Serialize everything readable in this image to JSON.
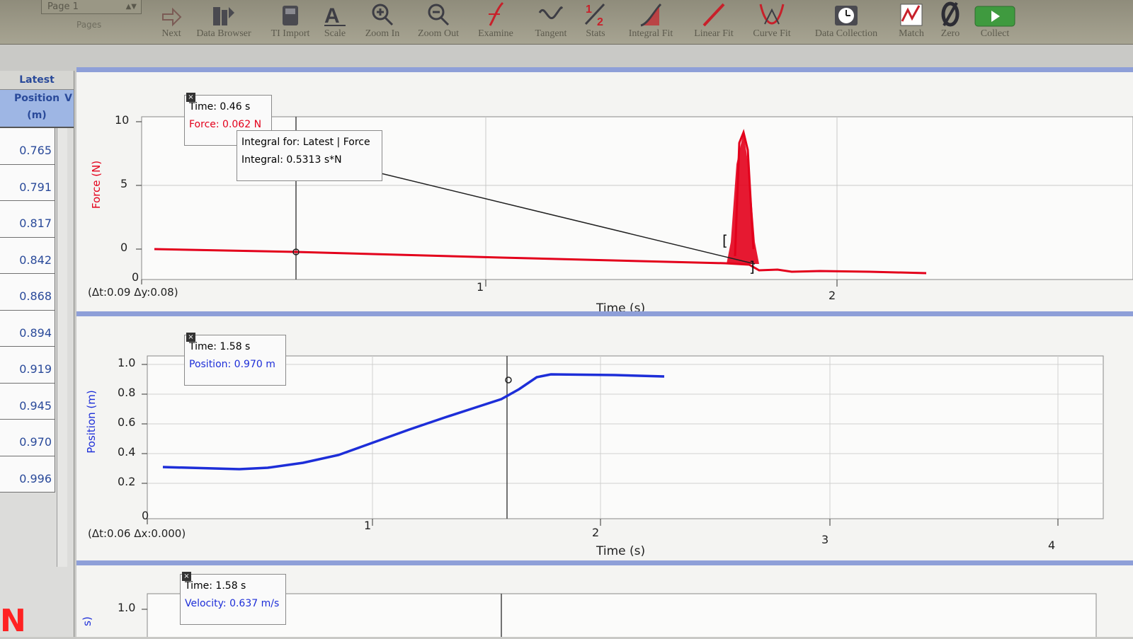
{
  "toolbar": {
    "page_select": "Page 1",
    "pages_label": "Pages",
    "tools": [
      {
        "label": "Next",
        "icon": "next-arrow-icon"
      },
      {
        "label": "Data Browser",
        "icon": "data-browser-icon"
      },
      {
        "label": "TI Import",
        "icon": "ti-import-icon"
      },
      {
        "label": "Scale",
        "icon": "autoscale-icon"
      },
      {
        "label": "Zoom In",
        "icon": "zoom-in-icon"
      },
      {
        "label": "Zoom Out",
        "icon": "zoom-out-icon"
      },
      {
        "label": "Examine",
        "icon": "examine-icon"
      },
      {
        "label": "Tangent",
        "icon": "tangent-icon"
      },
      {
        "label": "Stats",
        "icon": "stats-icon"
      },
      {
        "label": "Integral Fit",
        "icon": "integral-icon"
      },
      {
        "label": "Linear Fit",
        "icon": "linear-fit-icon"
      },
      {
        "label": "Curve Fit",
        "icon": "curve-fit-icon"
      },
      {
        "label": "Data Collection",
        "icon": "clock-icon"
      },
      {
        "label": "Match",
        "icon": "match-icon"
      },
      {
        "label": "Zero",
        "icon": "zero-icon"
      },
      {
        "label": "Collect",
        "icon": "collect-play-icon"
      }
    ]
  },
  "table": {
    "header_group": "Latest",
    "column_title": "Position",
    "column_unit": "(m)",
    "extra_col_hint": "V",
    "values": [
      "0.765",
      "0.791",
      "0.817",
      "0.842",
      "0.868",
      "0.894",
      "0.919",
      "0.945",
      "0.970",
      "0.996"
    ]
  },
  "bottom_left_symbol": "N",
  "force_graph": {
    "y_title": "Force (N)",
    "x_title": "Time (s)",
    "delta_text": "(Δt:0.09 Δy:0.08)",
    "x_ticks": [
      "0",
      "1",
      "2"
    ],
    "y_ticks": [
      "10",
      "5",
      "0"
    ],
    "callout_time": "Time: 0.46 s",
    "callout_force": "Force: 0.062 N",
    "integral_title": "Integral for: Latest | Force",
    "integral_value": "Integral: 0.5313 s*N",
    "colors": {
      "series": "#e3001b"
    }
  },
  "position_graph": {
    "y_title": "Position (m)",
    "x_title": "Time (s)",
    "delta_text": "(Δt:0.06 Δx:0.000)",
    "x_ticks": [
      "0",
      "1",
      "2",
      "3",
      "4"
    ],
    "y_ticks": [
      "1.0",
      "0.8",
      "0.6",
      "0.4",
      "0.2"
    ],
    "callout_time": "Time: 1.58 s",
    "callout_position": "Position: 0.970 m",
    "colors": {
      "series": "#1d2ed8"
    }
  },
  "velocity_graph": {
    "y_tick_top": "1.0",
    "y_title_fragment": "s)",
    "callout_time": "Time: 1.58 s",
    "callout_velocity": "Velocity: 0.637 m/s"
  }
}
